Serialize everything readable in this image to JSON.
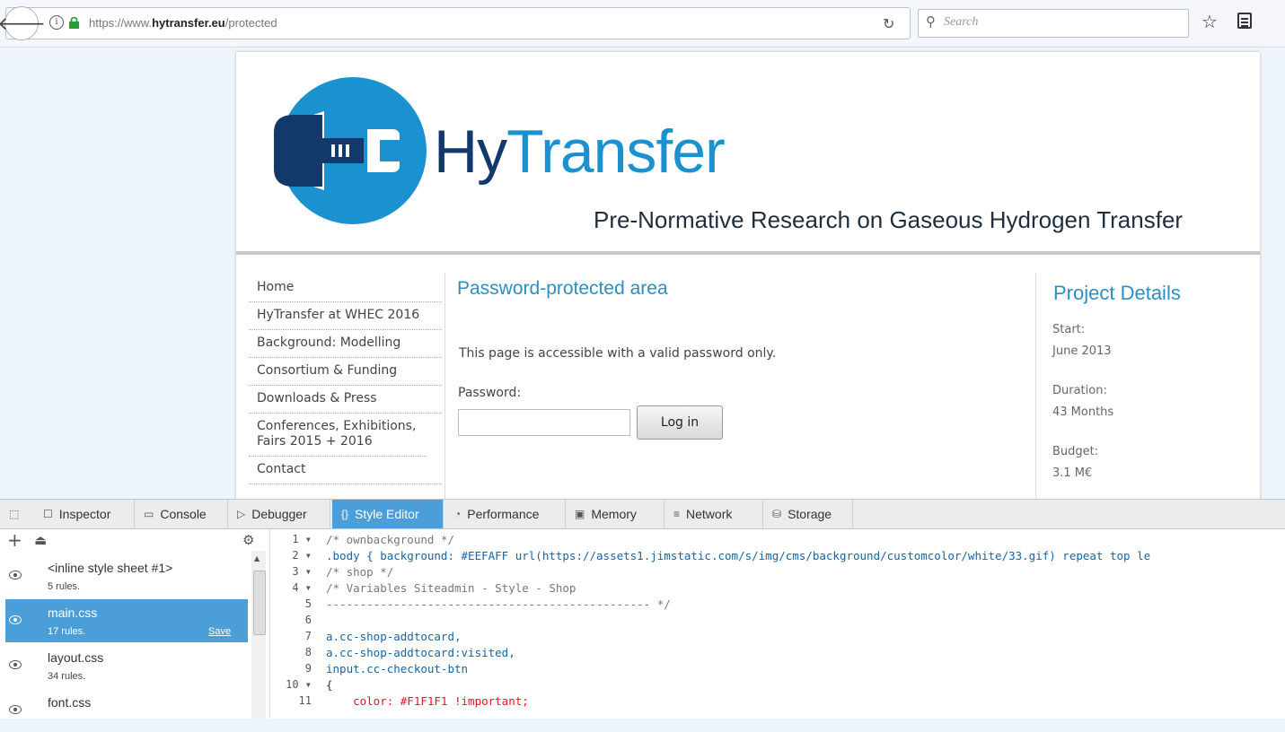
{
  "browser": {
    "url_prefix": "https://www.",
    "url_domain": "hytransfer.eu",
    "url_path": "/protected",
    "search_placeholder": "Search",
    "back_icon": "back-arrow",
    "reload_icon": "reload",
    "star_icon": "star",
    "reader_icon": "reading-list"
  },
  "site": {
    "logo_hy": "Hy",
    "logo_transfer": "Transfer",
    "subtitle": "Pre-Normative Research on Gaseous Hydrogen Transfer",
    "colors": {
      "dark_blue": "#13386a",
      "light_blue": "#1a92cf",
      "accent": "#2b8fc2"
    },
    "nav": [
      "Home",
      "HyTransfer at WHEC 2016",
      "Background: Modelling",
      "Consortium & Funding",
      "Downloads & Press",
      "Conferences, Exhibitions, Fairs 2015 + 2016",
      "Contact"
    ],
    "main": {
      "title": "Password-protected area",
      "description": "This page is accessible with a valid password only.",
      "password_label": "Password:",
      "password_value": "",
      "login_button": "Log in"
    },
    "project": {
      "title": "Project Details",
      "start_label": "Start:",
      "start_value": "June 2013",
      "duration_label": "Duration:",
      "duration_value": "43 Months",
      "budget_label": "Budget:",
      "budget_value": "3.1 M€"
    }
  },
  "devtools": {
    "tabs": [
      "Inspector",
      "Console",
      "Debugger",
      "Style Editor",
      "Performance",
      "Memory",
      "Network",
      "Storage"
    ],
    "active_tab": "Style Editor",
    "sheets": [
      {
        "name": "<inline style sheet #1>",
        "rules": "5 rules."
      },
      {
        "name": "main.css",
        "rules": "17 rules.",
        "save": "Save"
      },
      {
        "name": "layout.css",
        "rules": "34 rules."
      },
      {
        "name": "font.css",
        "rules": ""
      }
    ],
    "code_lines": [
      {
        "n": "1 ▾",
        "t": "/* ownbackground */"
      },
      {
        "n": "2 ▾",
        "t": ".body { background: #EEFAFF url(https://assets1.jimstatic.com/s/img/cms/background/customcolor/white/33.gif) repeat top le"
      },
      {
        "n": "3 ▾",
        "t": "/* shop */"
      },
      {
        "n": "4 ▾",
        "t": "/* Variables Siteadmin - Style - Shop"
      },
      {
        "n": "5",
        "t": "------------------------------------------------ */"
      },
      {
        "n": "6",
        "t": ""
      },
      {
        "n": "7",
        "t": "a.cc-shop-addtocard,"
      },
      {
        "n": "8",
        "t": "a.cc-shop-addtocard:visited,"
      },
      {
        "n": "9",
        "t": "input.cc-checkout-btn"
      },
      {
        "n": "10 ▾",
        "t": "{"
      },
      {
        "n": "11",
        "t": "    color: #F1F1F1 !important;"
      }
    ]
  }
}
